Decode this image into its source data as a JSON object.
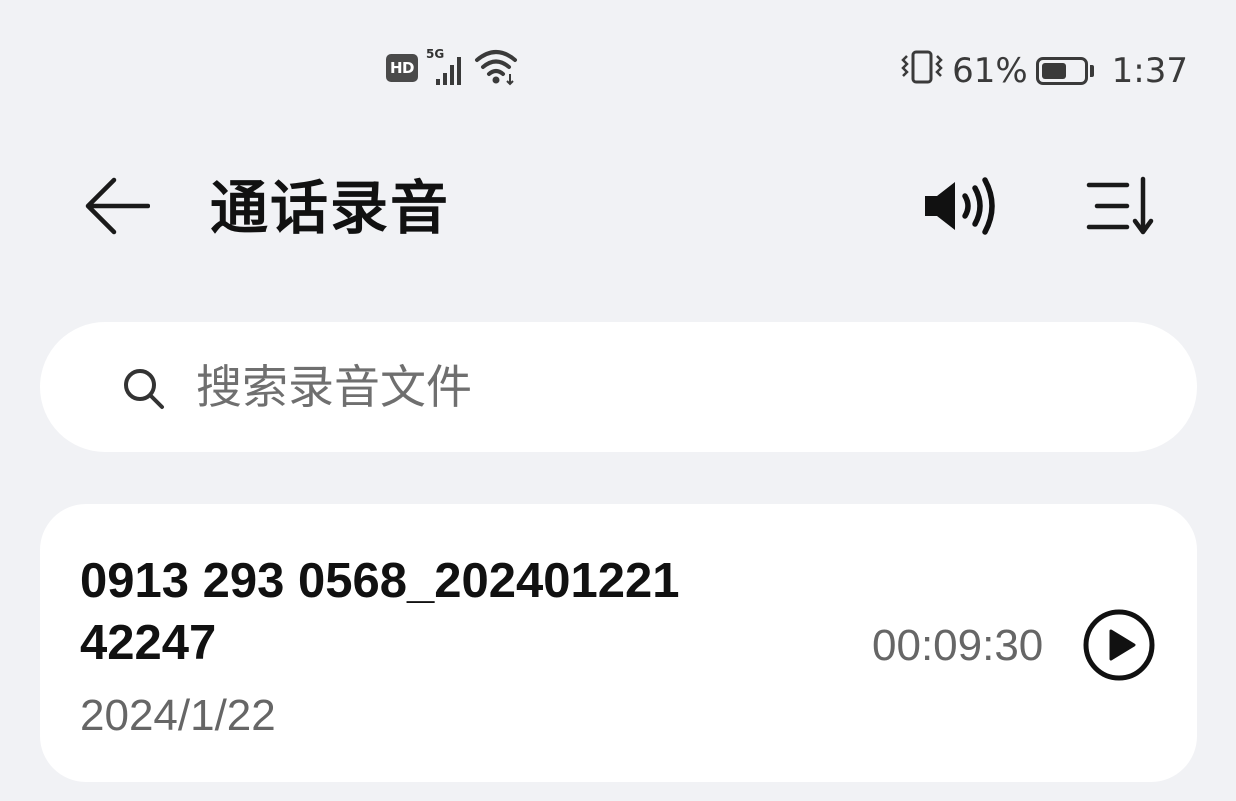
{
  "status_bar": {
    "hd_label": "HD",
    "network_type": "5G",
    "battery_level": 0.61,
    "battery_text": "61%",
    "time": "1:37"
  },
  "header": {
    "title": "通话录音",
    "back_icon": "back-arrow-icon",
    "speaker_icon": "speaker-icon",
    "sort_icon": "sort-icon"
  },
  "search": {
    "placeholder": "搜索录音文件",
    "value": ""
  },
  "recordings": [
    {
      "name": "0913 293 0568_20240122142247",
      "date": "2024/1/22",
      "duration": "00:09:30",
      "action_icon": "play-icon"
    }
  ],
  "colors": {
    "background": "#f1f2f5",
    "card": "#ffffff",
    "primary_text": "#111111",
    "secondary_text": "#666666"
  }
}
